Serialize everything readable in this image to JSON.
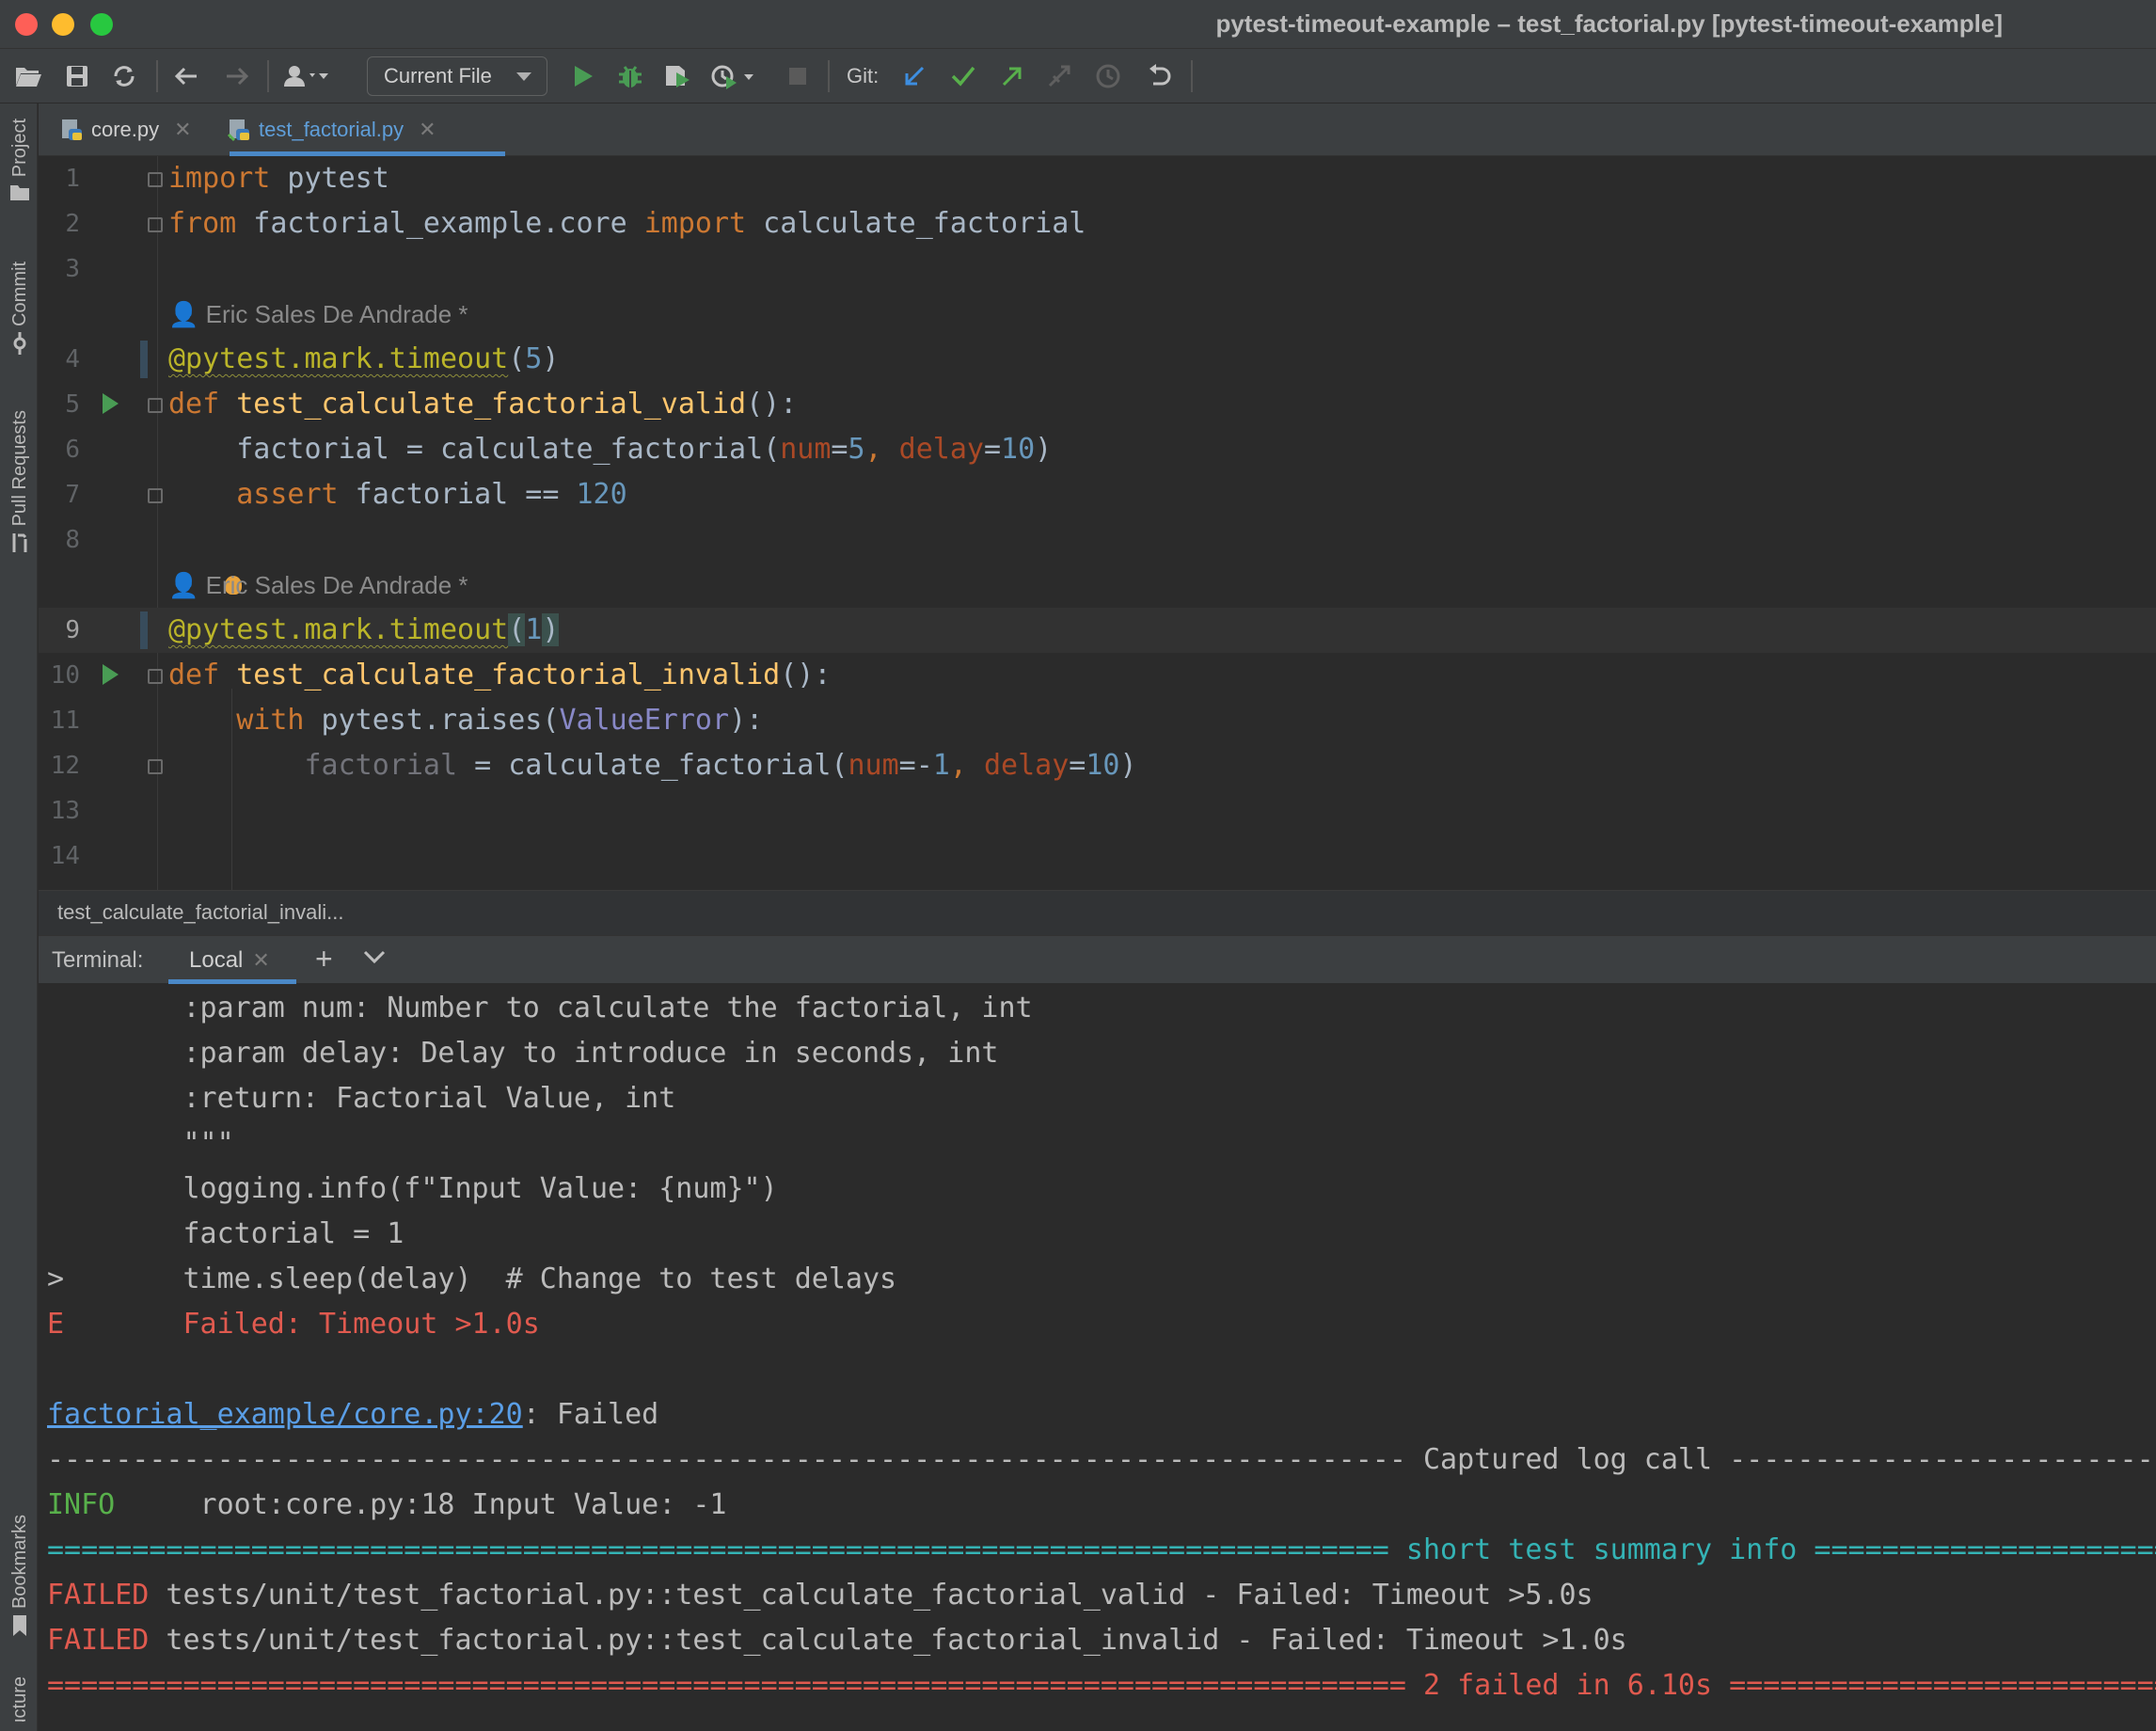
{
  "window": {
    "title": "pytest-timeout-example – test_factorial.py [pytest-timeout-example]"
  },
  "toolbar": {
    "run_config": "Current File",
    "git_label": "Git:",
    "icons": [
      "open-folder-icon",
      "save-icon",
      "sync-icon",
      "back-icon",
      "forward-icon",
      "user-icon",
      "run-icon",
      "debug-icon",
      "coverage-icon",
      "profile-icon",
      "stop-icon",
      "git-update-icon",
      "git-commit-icon",
      "git-push-icon",
      "git-branch-icon",
      "history-icon",
      "rollback-icon"
    ]
  },
  "left_strip": {
    "items": [
      "Project",
      "Commit",
      "Pull Requests",
      "Bookmarks",
      "Structure"
    ]
  },
  "editor_tabs": [
    {
      "label": "core.py",
      "active": false
    },
    {
      "label": "test_factorial.py",
      "active": true
    }
  ],
  "editor": {
    "author_annotation": "Eric Sales De Andrade *",
    "line_numbers": [
      "1",
      "2",
      "3",
      "4",
      "5",
      "6",
      "7",
      "8",
      "9",
      "10",
      "11",
      "12",
      "13",
      "14"
    ],
    "code": {
      "l1": [
        "import",
        " pytest"
      ],
      "l2": [
        "from",
        " factorial_example.core ",
        "import",
        " calculate_factorial"
      ],
      "l4": [
        "@pytest.mark.timeout",
        "(",
        "5",
        ")"
      ],
      "l5": [
        "def",
        " ",
        "test_calculate_factorial_valid",
        "():"
      ],
      "l6": [
        "    factorial = calculate_factorial(",
        "num",
        "=",
        "5",
        ", ",
        "delay",
        "=",
        "10",
        ")"
      ],
      "l7": [
        "    ",
        "assert",
        " factorial == ",
        "120"
      ],
      "l9": [
        "@pytest.mark.timeout",
        "(",
        "1",
        ")"
      ],
      "l10": [
        "def",
        " ",
        "test_calculate_factorial_invalid",
        "():"
      ],
      "l11": [
        "    ",
        "with",
        " pytest.raises(",
        "ValueError",
        "):"
      ],
      "l12": [
        "        ",
        "factorial",
        " = calculate_factorial(",
        "num",
        "=-",
        "1",
        ", ",
        "delay",
        "=",
        "10",
        ")"
      ]
    }
  },
  "breadcrumb": "test_calculate_factorial_invali...",
  "terminal": {
    "label": "Terminal:",
    "tab": "Local",
    "lines": {
      "t1": "        :param num: Number to calculate the factorial, int",
      "t2": "        :param delay: Delay to introduce in seconds, int",
      "t3": "        :return: Factorial Value, int",
      "t4": "        \"\"\"",
      "t5": "        logging.info(f\"Input Value: {num}\")",
      "t6": "        factorial = 1",
      "t7_prefix": ">",
      "t7": "       time.sleep(delay)  # Change to test delays",
      "t8_prefix": "E",
      "t8": "       Failed: Timeout >1.0s",
      "t10_link": "factorial_example/core.py:20",
      "t10_rest": ": Failed",
      "t11": "-------------------------------------------------------------------------------- Captured log call ------------------------------------------------------------------------------",
      "t12_level": "INFO",
      "t12": "     root:core.py:18 Input Value: -1",
      "t13": "=============================================================================== short test summary info ===============================================================================",
      "t14_status": "FAILED",
      "t14": " tests/unit/test_factorial.py::test_calculate_factorial_valid - Failed: Timeout >5.0s",
      "t15_status": "FAILED",
      "t15": " tests/unit/test_factorial.py::test_calculate_factorial_invalid - Failed: Timeout >1.0s",
      "t16": "================================================================================ 2 failed in 6.10s ================================================================================"
    }
  },
  "colors": {
    "background": "#2b2b2b",
    "chrome": "#3c3f41",
    "keyword": "#cc7832",
    "function": "#ffc66d",
    "number": "#6897bb",
    "decorator": "#bbb529",
    "error": "#e05a4f",
    "info": "#58b04b",
    "summary": "#34b3b5",
    "link": "#5a9ee6",
    "accent": "#4a88c7"
  }
}
